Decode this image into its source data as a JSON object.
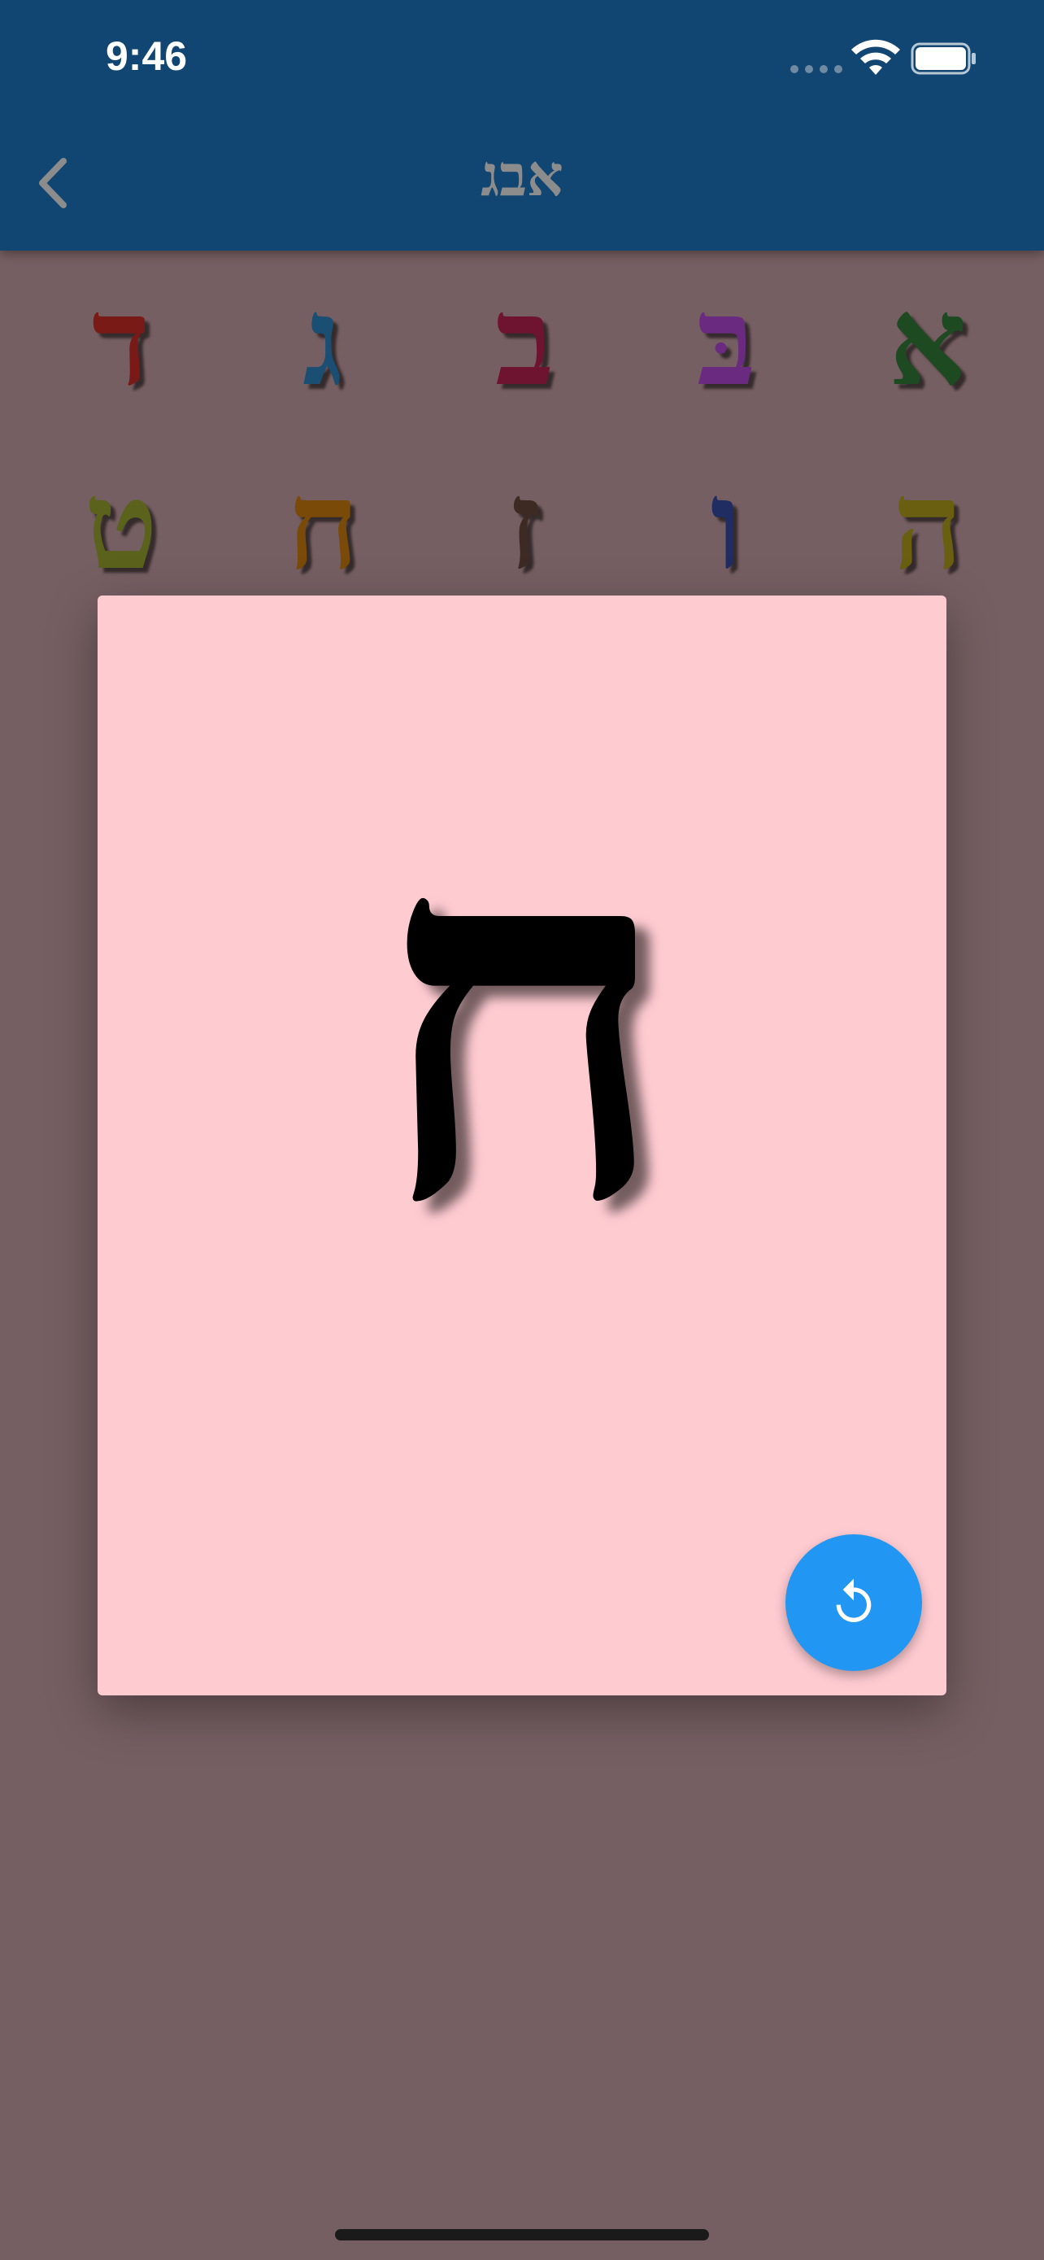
{
  "status_bar": {
    "time": "9:46"
  },
  "nav": {
    "title": "אבג"
  },
  "letters": [
    {
      "char": "ד",
      "color": "#7a1a17"
    },
    {
      "char": "ג",
      "color": "#1a4f73"
    },
    {
      "char": "ב",
      "color": "#6e1431"
    },
    {
      "char": "בּ",
      "color": "#6a2a80"
    },
    {
      "char": "א",
      "color": "#1e4a22"
    },
    {
      "char": "ט",
      "color": "#5a621b"
    },
    {
      "char": "ח",
      "color": "#7a4a08"
    },
    {
      "char": "ז",
      "color": "#3d2a22"
    },
    {
      "char": "ו",
      "color": "#1f2d63"
    },
    {
      "char": "ה",
      "color": "#6a5e10"
    }
  ],
  "card": {
    "letter": "ח",
    "background": "#fecbd1"
  },
  "reset_button": {
    "icon": "replay-icon",
    "color": "#2196f3"
  }
}
